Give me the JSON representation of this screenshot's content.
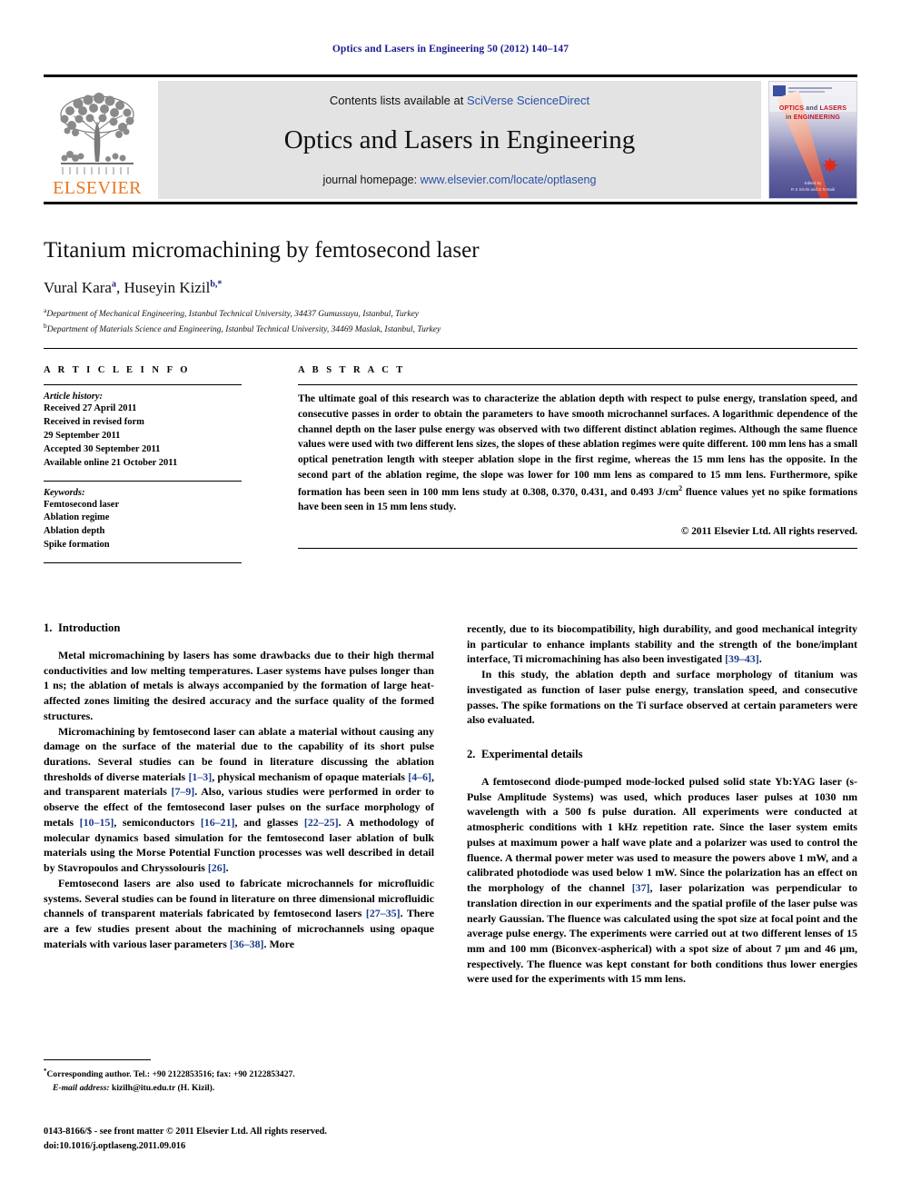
{
  "running_head": "Optics and Lasers in Engineering 50 (2012) 140–147",
  "masthead": {
    "contents_prefix": "Contents lists available at ",
    "contents_link": "SciVerse ScienceDirect",
    "journal_name": "Optics and Lasers in Engineering",
    "homepage_prefix": "journal homepage: ",
    "homepage_url": "www.elsevier.com/locate/optlaseng",
    "publisher_wordmark": "ELSEVIER",
    "publisher_color": "#E87722",
    "link_color": "#2a50a8",
    "cover": {
      "title_line1_red": "OPTICS",
      "title_line1_mid": " and ",
      "title_line1_red2": "LASERS",
      "title_line2_small": "in ",
      "title_line2_red": "ENGINEERING",
      "footer_line1": "Edited by",
      "footer_line2": "R S Sirohi and D N Naik"
    }
  },
  "title": "Titanium micromachining by femtosecond laser",
  "authors": {
    "author1": "Vural Kara",
    "author1_sup": "a",
    "separator": ", ",
    "author2": "Huseyin Kizil",
    "author2_sup": "b,*"
  },
  "affiliations": [
    {
      "sup": "a",
      "text": "Department of Mechanical Engineering, Istanbul Technical University, 34437 Gumussuyu, Istanbul, Turkey"
    },
    {
      "sup": "b",
      "text": "Department of Materials Science and Engineering, Istanbul Technical University, 34469 Maslak, Istanbul, Turkey"
    }
  ],
  "article_info": {
    "label": "A R T I C L E   I N F O",
    "history_head": "Article history:",
    "history": [
      "Received 27 April 2011",
      "Received in revised form",
      "29 September 2011",
      "Accepted 30 September 2011",
      "Available online 21 October 2011"
    ],
    "keywords_head": "Keywords:",
    "keywords": [
      "Femtosecond laser",
      "Ablation regime",
      "Ablation depth",
      "Spike formation"
    ]
  },
  "abstract": {
    "label": "A B S T R A C T",
    "part1": "The ultimate goal of this research was to characterize the ablation depth with respect to pulse energy, translation speed, and consecutive passes in order to obtain the parameters to have smooth microchannel surfaces. A logarithmic dependence of the channel depth on the laser pulse energy was observed with two different distinct ablation regimes. Although the same fluence values were used with two different lens sizes, the slopes of these ablation regimes were quite different. 100 mm lens has a small optical penetration length with steeper ablation slope in the first regime, whereas the 15 mm lens has the opposite. In the second part of the ablation regime, the slope was lower for 100 mm lens as compared to 15 mm lens. Furthermore, spike formation has been seen in 100 mm lens study at 0.308, 0.370, 0.431, and 0.493 J/cm",
    "superscript": "2",
    "part2": " fluence values yet no spike formations have been seen in 15 mm lens study.",
    "copyright": "© 2011 Elsevier Ltd. All rights reserved."
  },
  "sections": {
    "introduction": {
      "number": "1.",
      "title": "Introduction",
      "p1": "Metal micromachining by lasers has some drawbacks due to their high thermal conductivities and low melting temperatures. Laser systems have pulses longer than 1 ns; the ablation of metals is always accompanied by the formation of large heat-affected zones limiting the desired accuracy and the surface quality of the formed structures.",
      "p2_a": "Micromachining by femtosecond laser can ablate a material without causing any damage on the surface of the material due to the capability of its short pulse durations. Several studies can be found in literature discussing the ablation thresholds of diverse materials ",
      "p2_r1": "[1–3]",
      "p2_b": ", physical mechanism of opaque materials ",
      "p2_r2": "[4–6]",
      "p2_c": ", and transparent materials ",
      "p2_r3": "[7–9]",
      "p2_d": ". Also, various studies were performed in order to observe the effect of the femtosecond laser pulses on the surface morphology of metals ",
      "p2_r4": "[10–15]",
      "p2_e": ", semiconductors ",
      "p2_r5": "[16–21]",
      "p2_f": ", and glasses ",
      "p2_r6": "[22–25]",
      "p2_g": ". A methodology of molecular dynamics based simulation for the femtosecond laser ablation of bulk materials using the Morse Potential Function processes was well described in detail by Stavropoulos and Chryssolouris ",
      "p2_r7": "[26]",
      "p2_h": ".",
      "p3_a": "Femtosecond lasers are also used to fabricate microchannels for microfluidic systems. Several studies can be found in literature on three dimensional microfluidic channels of transparent materials fabricated by femtosecond lasers ",
      "p3_r1": "[27–35]",
      "p3_b": ". There are a few studies present about the machining of microchannels using opaque materials with various laser parameters ",
      "p3_r2": "[36–38]",
      "p3_c": ". More",
      "p4_a": "recently, due to its biocompatibility, high durability, and good mechanical integrity in particular to enhance implants stability and the strength of the bone/implant interface, Ti micromachining has also been investigated ",
      "p4_r1": "[39–43]",
      "p4_b": ".",
      "p5": "In this study, the ablation depth and surface morphology of titanium was investigated as function of laser pulse energy, translation speed, and consecutive passes. The spike formations on the Ti surface observed at certain parameters were also evaluated."
    },
    "experimental": {
      "number": "2.",
      "title": "Experimental details",
      "p1_a": "A femtosecond diode-pumped mode-locked pulsed solid state Yb:YAG laser (s-Pulse Amplitude Systems) was used, which produces laser pulses at 1030 nm wavelength with a 500 fs pulse duration. All experiments were conducted at atmospheric conditions with 1 kHz repetition rate. Since the laser system emits pulses at maximum power a half wave plate and a polarizer was used to control the fluence. A thermal power meter was used to measure the powers above 1 mW, and a calibrated photodiode was used below 1 mW. Since the polarization has an effect on the morphology of the channel ",
      "p1_r1": "[37]",
      "p1_b": ", laser polarization was perpendicular to translation direction in our experiments and the spatial profile of the laser pulse was nearly Gaussian. The fluence was calculated using the spot size at focal point and the average pulse energy. The experiments were carried out at two different lenses of 15 mm and 100 mm (Biconvex-aspherical) with a spot size of about 7 μm and 46 μm, respectively. The fluence was kept constant for both conditions thus lower energies were used for the experiments with 15 mm lens."
    }
  },
  "footnote": {
    "marker": "*",
    "corresponding": "Corresponding author. Tel.: +90 2122853516; fax: +90 2122853427.",
    "email_label": "E-mail address:",
    "email": " kizilh@itu.edu.tr (H. Kizil)."
  },
  "imprint": {
    "line1": "0143-8166/$ - see front matter © 2011 Elsevier Ltd. All rights reserved.",
    "line2": "doi:10.1016/j.optlaseng.2011.09.016"
  }
}
